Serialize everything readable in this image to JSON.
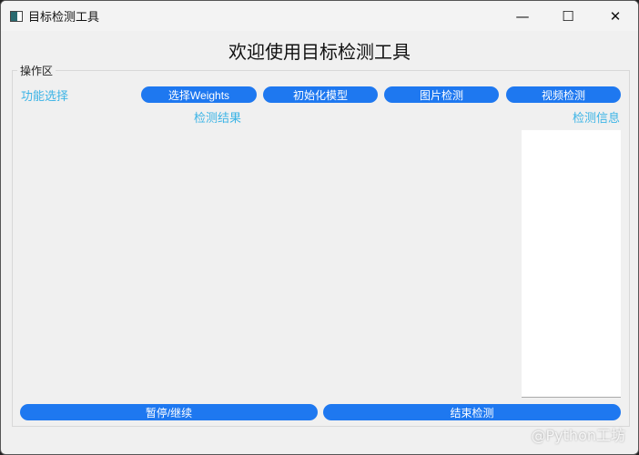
{
  "window": {
    "title": "目标检测工具",
    "minimize": "—",
    "maximize": "☐",
    "close": "✕"
  },
  "heading": "欢迎使用目标检测工具",
  "group_title": "操作区",
  "function_label": "功能选择",
  "buttons": {
    "select_weights": "选择Weights",
    "init_model": "初始化模型",
    "image_detect": "图片检测",
    "video_detect": "视频检测",
    "pause_resume": "暂停/继续",
    "stop_detect": "结束检测"
  },
  "result_label": "检测结果",
  "info_label": "检测信息",
  "watermark": "@Python工坊"
}
